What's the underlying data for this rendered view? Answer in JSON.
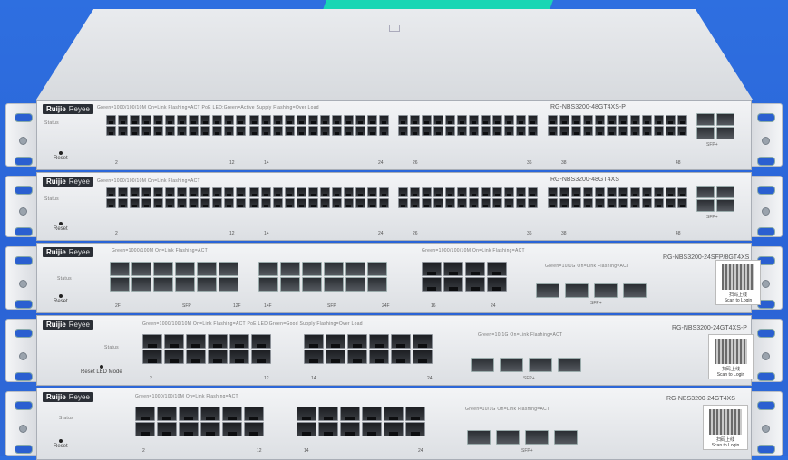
{
  "brand": "Ruijie",
  "brand_sub": "Reyee",
  "reset_label": "Reset",
  "reset_led_label": "Reset LED Mode",
  "status_label": "Status",
  "qr_text_1": "扫码上线",
  "qr_text_2": "Scan to Login",
  "units": [
    {
      "model": "RG-NBS3200-48GT4XS-P",
      "legend": "Green=1000/100/10M On=Link Flashing=ACT  PoE LED:Green=Active Supply Flashing=Over Load",
      "port_numbers": [
        "2",
        "12",
        "14",
        "24",
        "26",
        "36",
        "38",
        "48"
      ],
      "sfp_label": "SFP+"
    },
    {
      "model": "RG-NBS3200-48GT4XS",
      "legend": "Green=1000/100/10M On=Link Flashing=ACT",
      "port_numbers": [
        "2",
        "12",
        "14",
        "24",
        "26",
        "36",
        "38",
        "48"
      ],
      "sfp_label": "SFP+"
    },
    {
      "model": "RG-NBS3200-24SFP/8GT4XS",
      "legend": "Green=1000/100M On=Link Flashing=ACT",
      "legend2": "Green=1000/100/10M On=Link Flashing=ACT",
      "legend3": "Green=10/1G On=Link Flashing=ACT",
      "port_numbers": [
        "2F",
        "SFP",
        "12F",
        "14F",
        "SFP",
        "24F",
        "16",
        "24"
      ],
      "sfp_label": "SFP+"
    },
    {
      "model": "RG-NBS3200-24GT4XS-P",
      "legend": "Green=1000/100/10M On=Link Flashing=ACT  PoE LED:Green=Good Supply Flashing=Over Load",
      "legend3": "Green=10/1G On=Link Flashing=ACT",
      "port_numbers": [
        "2",
        "12",
        "14",
        "24"
      ],
      "sfp_label": "SFP+"
    },
    {
      "model": "RG-NBS3200-24GT4XS",
      "legend": "Green=1000/100/10M On=Link Flashing=ACT",
      "legend3": "Green=10/1G On=Link Flashing=ACT",
      "port_numbers": [
        "2",
        "12",
        "14",
        "24"
      ],
      "sfp_label": "SFP+"
    }
  ]
}
